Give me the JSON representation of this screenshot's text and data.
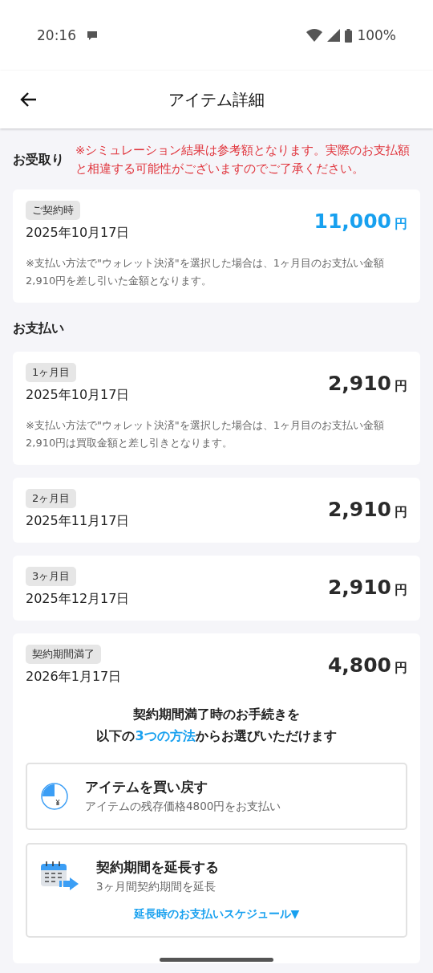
{
  "status_bar": {
    "time": "20:16",
    "battery": "100%"
  },
  "header": {
    "title": "アイテム詳細"
  },
  "receive": {
    "heading": "お受取り",
    "notice": "※シミュレーション結果は参考額となります。実際のお支払額と相違する可能性がございますのでご了承ください。",
    "card": {
      "tag": "ご契約時",
      "date": "2025年10月17日",
      "amount": "11,000",
      "unit": "円",
      "highlight": true,
      "note": "※支払い方法で\"ウォレット決済\"を選択した場合は、1ヶ月目のお支払い金額2,910円を差し引いた金額となります。"
    }
  },
  "payments": {
    "heading": "お支払い",
    "cards": [
      {
        "tag": "1ヶ月目",
        "date": "2025年10月17日",
        "amount": "2,910",
        "unit": "円",
        "highlight": false,
        "note": "※支払い方法で\"ウォレット決済\"を選択した場合は、1ヶ月目のお支払い金額2,910円は買取金額と差し引きとなります。"
      },
      {
        "tag": "2ヶ月目",
        "date": "2025年11月17日",
        "amount": "2,910",
        "unit": "円",
        "highlight": false
      },
      {
        "tag": "3ヶ月目",
        "date": "2025年12月17日",
        "amount": "2,910",
        "unit": "円",
        "highlight": false
      },
      {
        "tag": "契約期間満了",
        "date": "2026年1月17日",
        "amount": "4,800",
        "unit": "円",
        "highlight": false,
        "intro": [
          {
            "text": "契約期間満了時のお手続きを"
          },
          {
            "text": "以下の",
            "highlight": false
          },
          {
            "text": "3つの方法",
            "highlight": true
          },
          {
            "text": "からお選びいただけます",
            "highlight": false
          }
        ],
        "options": [
          {
            "kind": "buyback",
            "title": "アイテムを買い戻す",
            "subtitle": "アイテムの残存価格4800円をお支払い"
          },
          {
            "kind": "extend",
            "title": "契約期間を延長する",
            "subtitle": "3ヶ月間契約期間を延長",
            "link": "延長時のお支払いスケジュール▼"
          }
        ]
      }
    ]
  }
}
